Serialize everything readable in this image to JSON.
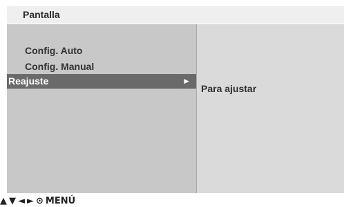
{
  "header": {
    "title": "Pantalla"
  },
  "menu": {
    "items": [
      {
        "label": "Config. Auto",
        "selected": false
      },
      {
        "label": "Config. Manual",
        "selected": false
      },
      {
        "label": "Reajuste",
        "selected": true,
        "submenu_arrow": "►"
      }
    ]
  },
  "description": {
    "text": "Para ajustar"
  },
  "footer": {
    "nav_up": "▲",
    "nav_down": "▼",
    "nav_left": "◄",
    "nav_right": "►",
    "ok_symbol": "⊙",
    "menu_label": "MENÚ"
  },
  "colors": {
    "header_bg": "#efefef",
    "left_panel_bg": "#c8c8c8",
    "right_panel_bg": "#dadada",
    "selected_bg": "#6a6a6a",
    "selected_text": "#ffffff"
  }
}
